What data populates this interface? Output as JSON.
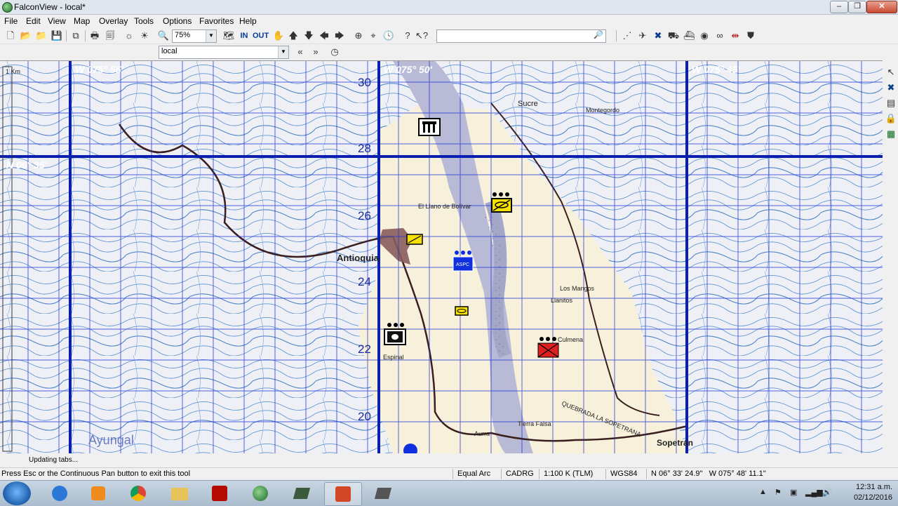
{
  "window": {
    "title": "FalconView - local*",
    "min": "0",
    "max": "1",
    "close": "r"
  },
  "menu": [
    "File",
    "Edit",
    "View",
    "Map",
    "Overlay",
    "Tools",
    "Options",
    "Favorites",
    "Help"
  ],
  "toolbar": {
    "zoom_value": "75%",
    "zoom_in": "IN",
    "zoom_out": "OUT",
    "search_value": ""
  },
  "toolbar2": {
    "map_name": "local"
  },
  "map": {
    "longitude_labels": [
      "W 075° 55'",
      "W 075° 50'",
      "W 075° 45'"
    ],
    "latitude_labels": [
      "N 06° 35'"
    ],
    "grid_numbers": [
      "30",
      "28",
      "26",
      "24",
      "22",
      "20"
    ],
    "scale_label": "1 Km",
    "places": [
      "Antioquia",
      "Sopetrán",
      "Sucre",
      "El Llano de Bolívar",
      "Espinal",
      "Culmena",
      "Los Mangos",
      "Llanitos",
      "Montegordo",
      "Tierra Falsa",
      "Aurra",
      "QUEBRADA LA SOPETRANA",
      "Ayungal"
    ],
    "symbols": [
      {
        "name": "unit-symbol-depot",
        "color": "#000000"
      },
      {
        "name": "unit-symbol-yellow-large",
        "color": "#f5e000"
      },
      {
        "name": "unit-symbol-yellow-small",
        "color": "#f5e000"
      },
      {
        "name": "unit-symbol-blue-aspc",
        "color": "#1030e0",
        "text": "ASPC"
      },
      {
        "name": "unit-symbol-yellow-tiny",
        "color": "#f5e000"
      },
      {
        "name": "unit-symbol-camera",
        "color": "#000000"
      },
      {
        "name": "unit-symbol-red-hostile",
        "color": "#e02020"
      }
    ]
  },
  "status": {
    "updating": "Updating tabs...",
    "hint": "Press Esc or the Continuous Pan button to exit this tool",
    "projection": "Equal Arc",
    "source": "CADRG",
    "scale": "1:100 K (TLM)",
    "datum": "WGS84",
    "coords": "N 06° 33' 24.9\"   W 075° 48' 11.1\""
  },
  "taskbar": {
    "time": "12:31 a.m.",
    "date": "02/12/2016"
  }
}
